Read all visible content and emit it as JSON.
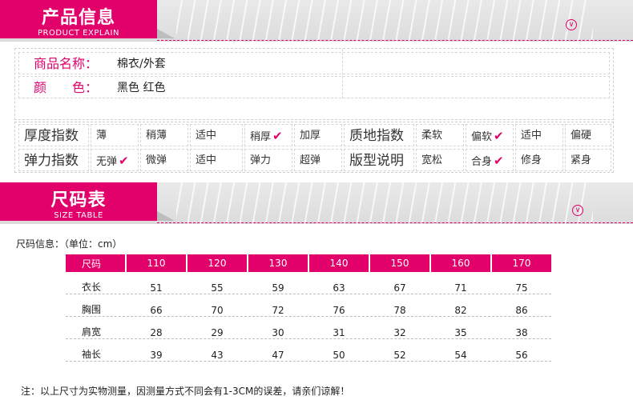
{
  "section1": {
    "title_cn": "产品信息",
    "title_en": "PRODUCT EXPLAIN"
  },
  "section2": {
    "title_cn": "尺码表",
    "title_en": "SIZE TABLE"
  },
  "circle_icon": "chevron-down-icon",
  "product": {
    "name_label": "商品名称：",
    "name_value": "棉衣/外套",
    "color_label": "颜　　色：",
    "color_value": "黑色  红色"
  },
  "attrs": {
    "row1": {
      "h1": "厚度指数",
      "o1": [
        "薄",
        "稍薄",
        "适中",
        "稍厚",
        "加厚"
      ],
      "h2": "质地指数",
      "o2": [
        "柔软",
        "偏软",
        "适中",
        "偏硬"
      ]
    },
    "row2": {
      "h1": "弹力指数",
      "o1": [
        "无弹",
        "微弹",
        "适中",
        "弹力",
        "超弹"
      ],
      "h2": "版型说明",
      "o2": [
        "宽松",
        "合身",
        "修身",
        "紧身"
      ]
    }
  },
  "size": {
    "note": "尺码信息：（单位：cm）",
    "header": [
      "尺码",
      "110",
      "120",
      "130",
      "140",
      "150",
      "160",
      "170"
    ],
    "rows": [
      [
        "衣长",
        "51",
        "55",
        "59",
        "63",
        "67",
        "71",
        "75"
      ],
      [
        "胸围",
        "66",
        "70",
        "72",
        "76",
        "78",
        "82",
        "86"
      ],
      [
        "肩宽",
        "28",
        "29",
        "30",
        "31",
        "32",
        "35",
        "38"
      ],
      [
        "袖长",
        "39",
        "43",
        "47",
        "50",
        "52",
        "54",
        "56"
      ]
    ]
  },
  "footnote": "注：以上尺寸为实物测量，因测量方式不同会有1-3CM的误差，请亲们谅解！",
  "colors": {
    "accent": "#e2006a"
  }
}
